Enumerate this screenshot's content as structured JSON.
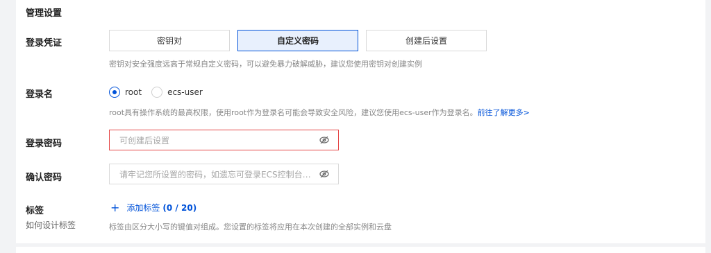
{
  "section_title": "管理设置",
  "login_credential": {
    "label": "登录凭证",
    "options": [
      "密钥对",
      "自定义密码",
      "创建后设置"
    ],
    "selected": "自定义密码",
    "hint": "密钥对安全强度远高于常规自定义密码，可以避免暴力破解威胁，建议您使用密钥对创建实例"
  },
  "login_name": {
    "label": "登录名",
    "options": [
      "root",
      "ecs-user"
    ],
    "selected": "root",
    "hint": "root具有操作系统的最高权限，使用root作为登录名可能会导致安全风险，建议您使用ecs-user作为登录名。",
    "learn_more": "前往了解更多>"
  },
  "login_password": {
    "label": "登录密码",
    "placeholder": "可创建后设置"
  },
  "confirm_password": {
    "label": "确认密码",
    "placeholder": "请牢记您所设置的密码，如遗忘可登录ECS控制台重置..."
  },
  "tags": {
    "label": "标签",
    "help_link": "如何设计标签",
    "add_label": "添加标签",
    "count": "(0 / 20)",
    "hint": "标签由区分大小写的键值对组成。您设置的标签将应用在本次创建的全部实例和云盘"
  },
  "colors": {
    "accent": "#0052d9",
    "error_border": "#e54545",
    "active_bg": "#e8f0fd"
  }
}
